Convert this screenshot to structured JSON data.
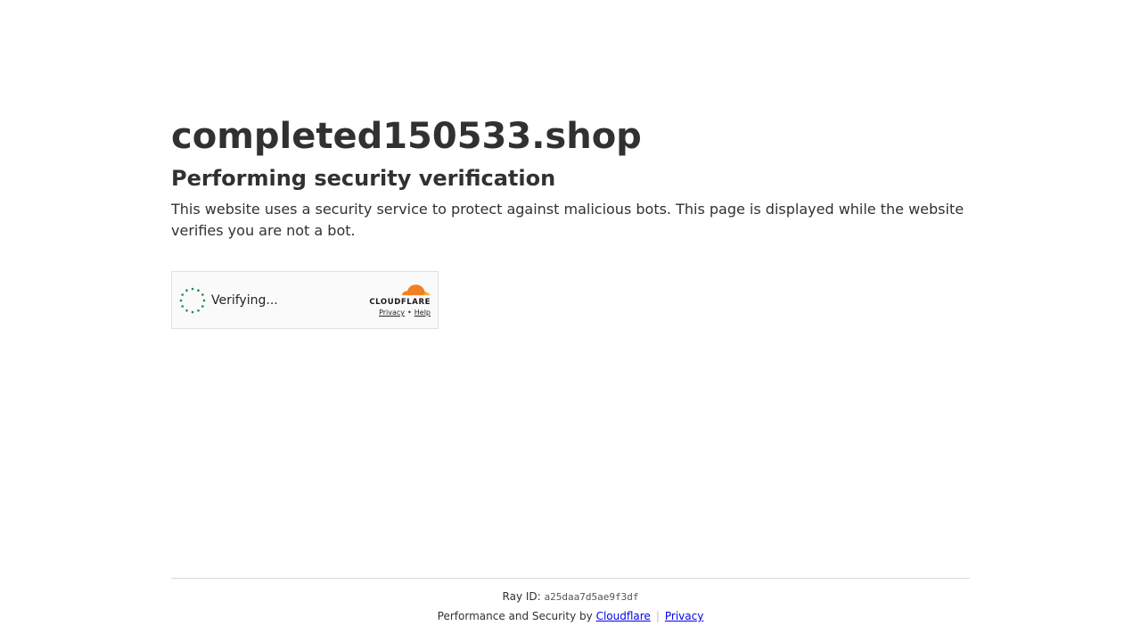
{
  "site": {
    "domain": "completed150533.shop"
  },
  "content": {
    "heading": "Performing security verification",
    "description": "This website uses a security service to protect against malicious bots. This page is displayed while the website verifies you are not a bot."
  },
  "widget": {
    "status": "Verifying...",
    "brand": "CLOUDFLARE",
    "privacy_link": "Privacy",
    "separator": "•",
    "help_link": "Help",
    "spinner_color": "#1a8a4c",
    "cloud_color": "#f38020",
    "cloud_color_light": "#faae40"
  },
  "footer": {
    "ray_label": "Ray ID:",
    "ray_id": "a25daa7d5ae9f3df",
    "perf_text": "Performance and Security by",
    "cloudflare_link": "Cloudflare",
    "separator": "|",
    "privacy_link": "Privacy"
  }
}
